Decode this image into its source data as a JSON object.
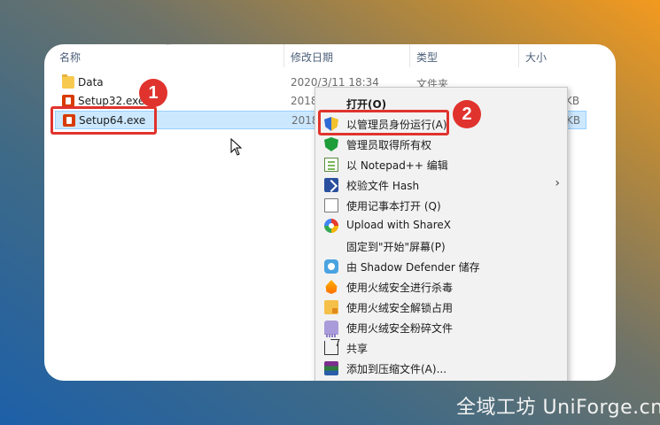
{
  "explorer": {
    "columns": {
      "name": "名称",
      "modified": "修改日期",
      "type": "类型",
      "size": "大小"
    },
    "files": [
      {
        "name": "Data",
        "date": "2020/3/11 18:34",
        "type": "文件夹",
        "size": "",
        "icon": "folder-icon"
      },
      {
        "name": "Setup32.exe",
        "date": "2018",
        "type": "",
        "size": "KB",
        "icon": "office-icon"
      },
      {
        "name": "Setup64.exe",
        "date": "2018",
        "type": "",
        "size": "KB",
        "icon": "office-icon"
      }
    ]
  },
  "context_menu": {
    "items": [
      {
        "label": "打开(O)",
        "icon": "",
        "bold": true
      },
      {
        "label": "以管理员身份运行(A)",
        "icon": "shield-icon"
      },
      {
        "label": "管理员取得所有权",
        "icon": "shield-check-icon"
      },
      {
        "label": "以 Notepad++ 编辑",
        "icon": "notepad-icon"
      },
      {
        "label": "校验文件 Hash",
        "icon": "hash-icon",
        "submenu": true
      },
      {
        "label": "使用记事本打开 (Q)",
        "icon": "doc-icon"
      },
      {
        "label": "Upload with ShareX",
        "icon": "sharex-icon"
      },
      {
        "label": "固定到\"开始\"屏幕(P)",
        "icon": ""
      },
      {
        "label": "由 Shadow Defender 储存",
        "icon": "defender-icon"
      },
      {
        "label": "使用火绒安全进行杀毒",
        "icon": "fire-icon"
      },
      {
        "label": "使用火绒安全解锁占用",
        "icon": "folder-lock-icon"
      },
      {
        "label": "使用火绒安全粉碎文件",
        "icon": "shredder-icon"
      },
      {
        "label": "共享",
        "icon": "share-icon"
      },
      {
        "label": "添加到压缩文件(A)...",
        "icon": "winrar-icon"
      }
    ]
  },
  "annotations": {
    "step1": "1",
    "step2": "2",
    "accent_color": "#e0332e"
  },
  "watermark": "全域工坊 UniForge.cn"
}
